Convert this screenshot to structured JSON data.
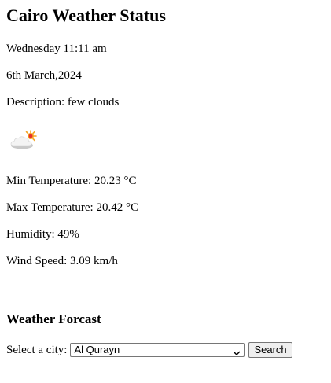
{
  "title": "Cairo Weather Status",
  "current": {
    "day_time": "Wednesday 11:11 am",
    "date": "6th March,2024",
    "description": "Description: few clouds",
    "icon": "few-clouds-icon",
    "min_temp": "Min Temperature: 20.23 °C",
    "max_temp": "Max Temperature: 20.42 °C",
    "humidity": "Humidity: 49%",
    "wind_speed": "Wind Speed: 3.09 km/h"
  },
  "forecast": {
    "heading": "Weather Forcast",
    "select_label": "Select a city:",
    "selected_city": "Al Qurayn",
    "search_label": "Search"
  },
  "colors": {
    "sun": "#f5a623",
    "sun_core": "#e8302a",
    "cloud": "#ffffff",
    "cloud_shadow": "#c9c9c9"
  }
}
